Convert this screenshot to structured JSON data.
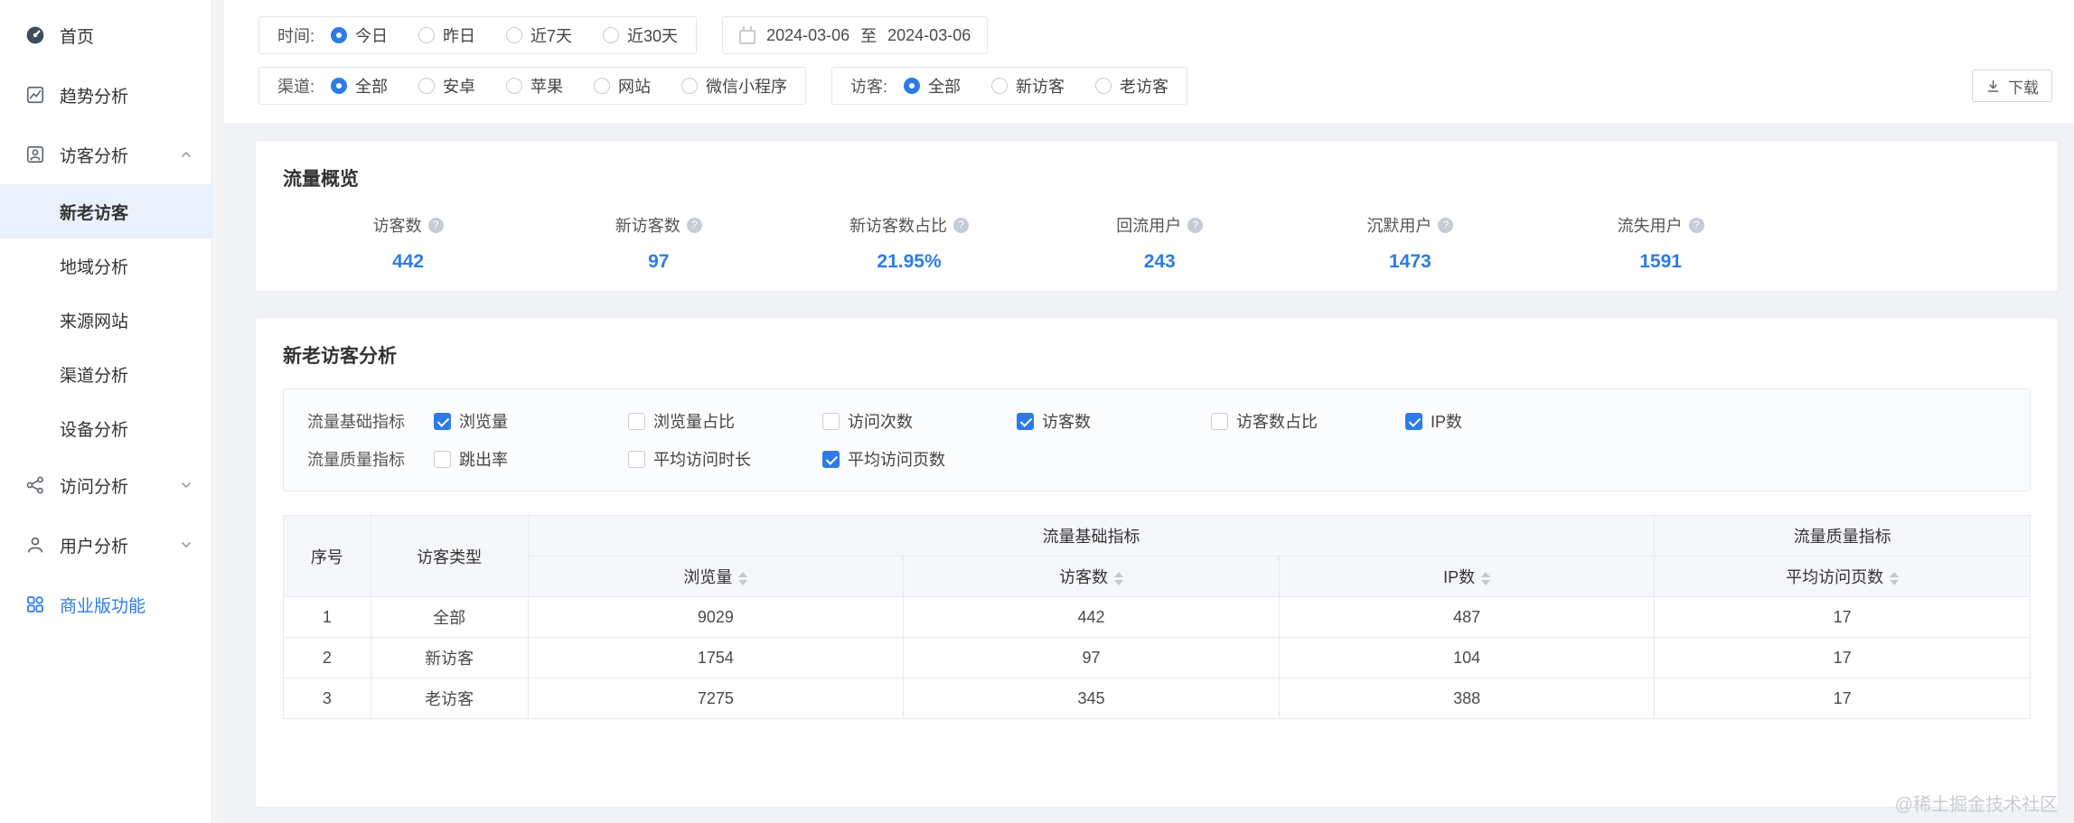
{
  "colors": {
    "accent": "#2d7ce6",
    "sidebar_selected_bg": "#e9f1fc"
  },
  "icons": {
    "help_glyph": "?"
  },
  "sidebar": {
    "items": [
      {
        "label": "首页"
      },
      {
        "label": "趋势分析"
      },
      {
        "label": "访客分析",
        "expanded": true
      },
      {
        "label": "访问分析",
        "expanded": false
      },
      {
        "label": "用户分析",
        "expanded": false
      },
      {
        "label": "商业版功能"
      }
    ],
    "visitor_children": [
      "新老访客",
      "地域分析",
      "来源网站",
      "渠道分析",
      "设备分析"
    ],
    "selected": "新老访客"
  },
  "filters": {
    "time_label": "时间:",
    "time_options": [
      "今日",
      "昨日",
      "近7天",
      "近30天"
    ],
    "time_selected": "今日",
    "date_start": "2024-03-06",
    "date_separator": "至",
    "date_end": "2024-03-06",
    "channel_label": "渠道:",
    "channel_options": [
      "全部",
      "安卓",
      "苹果",
      "网站",
      "微信小程序"
    ],
    "channel_selected": "全部",
    "visitor_label": "访客:",
    "visitor_options": [
      "全部",
      "新访客",
      "老访客"
    ],
    "visitor_selected": "全部",
    "download_label": "下载"
  },
  "overview": {
    "title": "流量概览",
    "metrics": [
      {
        "label": "访客数",
        "value": "442"
      },
      {
        "label": "新访客数",
        "value": "97"
      },
      {
        "label": "新访客数占比",
        "value": "21.95%"
      },
      {
        "label": "回流用户",
        "value": "243"
      },
      {
        "label": "沉默用户",
        "value": "1473"
      },
      {
        "label": "流失用户",
        "value": "1591"
      }
    ]
  },
  "analysis": {
    "title": "新老访客分析",
    "basic_label": "流量基础指标",
    "basic_options": [
      {
        "label": "浏览量",
        "checked": true
      },
      {
        "label": "浏览量占比",
        "checked": false
      },
      {
        "label": "访问次数",
        "checked": false
      },
      {
        "label": "访客数",
        "checked": true
      },
      {
        "label": "访客数占比",
        "checked": false
      },
      {
        "label": "IP数",
        "checked": true
      }
    ],
    "quality_label": "流量质量指标",
    "quality_options": [
      {
        "label": "跳出率",
        "checked": false
      },
      {
        "label": "平均访问时长",
        "checked": false
      },
      {
        "label": "平均访问页数",
        "checked": true
      }
    ],
    "table": {
      "col_seq": "序号",
      "col_type": "访客类型",
      "group_basic": "流量基础指标",
      "group_quality": "流量质量指标",
      "sub_headers": [
        "浏览量",
        "访客数",
        "IP数",
        "平均访问页数"
      ],
      "rows": [
        {
          "seq": "1",
          "type": "全部",
          "values": [
            "9029",
            "442",
            "487",
            "17"
          ]
        },
        {
          "seq": "2",
          "type": "新访客",
          "values": [
            "1754",
            "97",
            "104",
            "17"
          ]
        },
        {
          "seq": "3",
          "type": "老访客",
          "values": [
            "7275",
            "345",
            "388",
            "17"
          ]
        }
      ]
    }
  },
  "watermark": "@稀土掘金技术社区"
}
